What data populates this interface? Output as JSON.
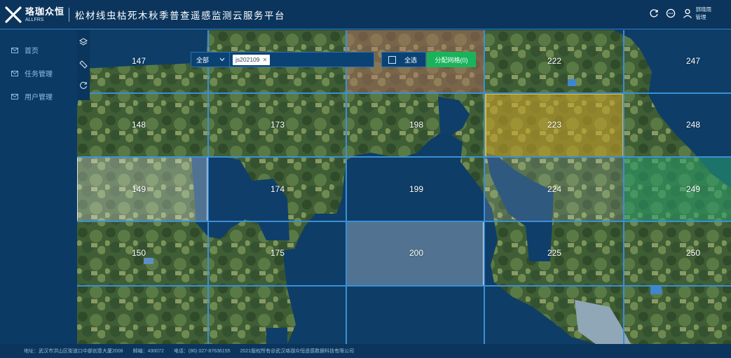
{
  "header": {
    "logo_cn": "珞珈众恒",
    "logo_en": "ALLFRS",
    "title": "松材线虫枯死木秋季普查遥感监测云服务平台",
    "user": {
      "name": "郭晓雨",
      "role": "管理"
    },
    "icons": [
      "refresh-icon",
      "message-icon",
      "user-icon"
    ]
  },
  "sidebar": {
    "items": [
      {
        "label": "首页",
        "icon": "mail-icon"
      },
      {
        "label": "任务管理",
        "icon": "mail-icon"
      },
      {
        "label": "用户管理",
        "icon": "mail-icon"
      }
    ]
  },
  "filters": {
    "select_value": "全部",
    "tag": "js202109",
    "select_all_label": "全选",
    "assign_label": "分配网格(0)"
  },
  "grid": {
    "cells": [
      "147",
      "148",
      "149",
      "150",
      "173",
      "174",
      "175",
      "198",
      "199",
      "200",
      "222",
      "223",
      "224",
      "225",
      "247",
      "248",
      "249",
      "250"
    ]
  },
  "colors": {
    "background": "#0d3a63",
    "grid_line": "#3a8fd6",
    "assign_button": "#19b35c",
    "selected_yellow": "#e3b82a",
    "selected_green": "#28a06e"
  },
  "footer": {
    "address": "地址：武汉市洪山区街道口中部创意大厦2008",
    "postcode": "邮编：430072",
    "phone": "电话：(86) 027-87636155",
    "copyright": "2021版权所有@武汉珞珈众恒遥感数据科技有限公司"
  }
}
